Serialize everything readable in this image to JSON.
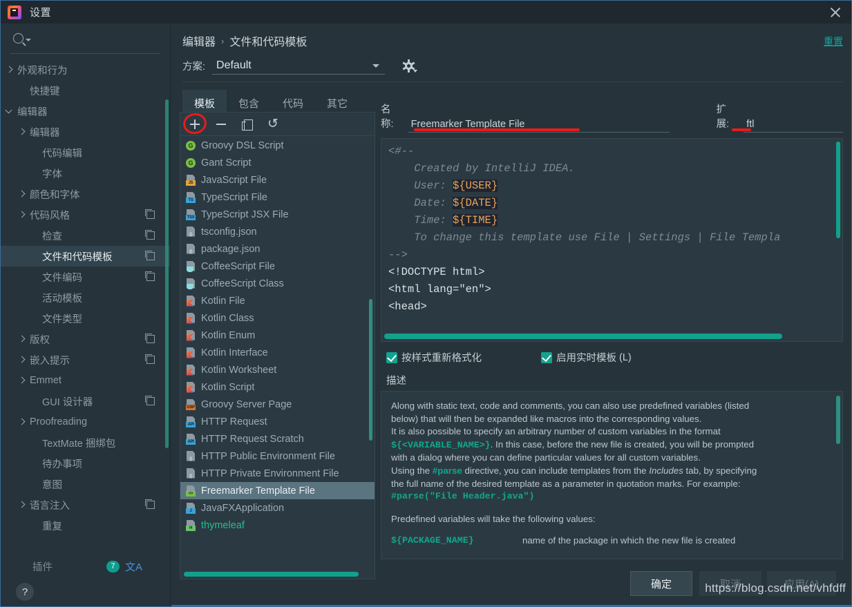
{
  "window": {
    "title": "设置",
    "close_icon": "close-icon"
  },
  "sidebar": {
    "search_placeholder": "",
    "items": [
      {
        "label": "外观和行为",
        "arrow": "right",
        "indent": 22,
        "copy": false,
        "selected": false
      },
      {
        "label": "快捷键",
        "arrow": "none",
        "indent": 40,
        "copy": false,
        "selected": false
      },
      {
        "label": "编辑器",
        "arrow": "down",
        "indent": 22,
        "copy": false,
        "selected": false
      },
      {
        "label": "编辑器",
        "arrow": "right",
        "indent": 40,
        "copy": false,
        "selected": false
      },
      {
        "label": "代码编辑",
        "arrow": "none",
        "indent": 58,
        "copy": false,
        "selected": false
      },
      {
        "label": "字体",
        "arrow": "none",
        "indent": 58,
        "copy": false,
        "selected": false
      },
      {
        "label": "颜色和字体",
        "arrow": "right",
        "indent": 40,
        "copy": false,
        "selected": false
      },
      {
        "label": "代码风格",
        "arrow": "right",
        "indent": 40,
        "copy": true,
        "selected": false
      },
      {
        "label": "检查",
        "arrow": "none",
        "indent": 58,
        "copy": true,
        "selected": false
      },
      {
        "label": "文件和代码模板",
        "arrow": "none",
        "indent": 58,
        "copy": true,
        "selected": true
      },
      {
        "label": "文件编码",
        "arrow": "none",
        "indent": 58,
        "copy": true,
        "selected": false
      },
      {
        "label": "活动模板",
        "arrow": "none",
        "indent": 58,
        "copy": false,
        "selected": false
      },
      {
        "label": "文件类型",
        "arrow": "none",
        "indent": 58,
        "copy": false,
        "selected": false
      },
      {
        "label": "版权",
        "arrow": "right",
        "indent": 40,
        "copy": true,
        "selected": false
      },
      {
        "label": "嵌入提示",
        "arrow": "right",
        "indent": 40,
        "copy": true,
        "selected": false
      },
      {
        "label": "Emmet",
        "arrow": "right",
        "indent": 40,
        "copy": false,
        "selected": false
      },
      {
        "label": "GUI 设计器",
        "arrow": "none",
        "indent": 58,
        "copy": true,
        "selected": false
      },
      {
        "label": "Proofreading",
        "arrow": "right",
        "indent": 40,
        "copy": false,
        "selected": false
      },
      {
        "label": "TextMate 捆绑包",
        "arrow": "none",
        "indent": 58,
        "copy": false,
        "selected": false
      },
      {
        "label": "待办事项",
        "arrow": "none",
        "indent": 58,
        "copy": false,
        "selected": false
      },
      {
        "label": "意图",
        "arrow": "none",
        "indent": 58,
        "copy": false,
        "selected": false
      },
      {
        "label": "语言注入",
        "arrow": "right",
        "indent": 40,
        "copy": true,
        "selected": false
      },
      {
        "label": "重复",
        "arrow": "none",
        "indent": 58,
        "copy": false,
        "selected": false
      }
    ],
    "plugins": {
      "label": "插件",
      "badge": "7",
      "lang_icon": "文A"
    },
    "help_label": "?"
  },
  "header": {
    "breadcrumb": [
      "编辑器",
      "文件和代码模板"
    ],
    "separator": "›",
    "reset_label": "重置",
    "scheme_label": "方案:",
    "scheme_value": "Default",
    "gear_icon": "gear-icon"
  },
  "tabs": [
    {
      "label": "模板",
      "active": true
    },
    {
      "label": "包含",
      "active": false
    },
    {
      "label": "代码",
      "active": false
    },
    {
      "label": "其它",
      "active": false
    }
  ],
  "list_toolbar": {
    "add": "+",
    "remove": "−",
    "copy": "copy-icon",
    "revert": "↺"
  },
  "templates": [
    {
      "name": "Groovy DSL Script",
      "icon": "groovy",
      "selected": false
    },
    {
      "name": "Gant Script",
      "icon": "groovy",
      "selected": false
    },
    {
      "name": "JavaScript File",
      "icon": "js",
      "selected": false
    },
    {
      "name": "TypeScript File",
      "icon": "ts",
      "selected": false
    },
    {
      "name": "TypeScript JSX File",
      "icon": "tsx",
      "selected": false
    },
    {
      "name": "tsconfig.json",
      "icon": "json",
      "selected": false
    },
    {
      "name": "package.json",
      "icon": "json",
      "selected": false
    },
    {
      "name": "CoffeeScript File",
      "icon": "coffee",
      "selected": false
    },
    {
      "name": "CoffeeScript Class",
      "icon": "coffee",
      "selected": false
    },
    {
      "name": "Kotlin File",
      "icon": "kotlin",
      "selected": false
    },
    {
      "name": "Kotlin Class",
      "icon": "kotlin",
      "selected": false
    },
    {
      "name": "Kotlin Enum",
      "icon": "kotlin",
      "selected": false
    },
    {
      "name": "Kotlin Interface",
      "icon": "kotlin",
      "selected": false
    },
    {
      "name": "Kotlin Worksheet",
      "icon": "kotlin",
      "selected": false
    },
    {
      "name": "Kotlin Script",
      "icon": "kotlin",
      "selected": false
    },
    {
      "name": "Groovy Server Page",
      "icon": "gsp",
      "selected": false
    },
    {
      "name": "HTTP Request",
      "icon": "api",
      "selected": false
    },
    {
      "name": "HTTP Request Scratch",
      "icon": "api",
      "selected": false
    },
    {
      "name": "HTTP Public Environment File",
      "icon": "json",
      "selected": false
    },
    {
      "name": "HTTP Private Environment File",
      "icon": "json",
      "selected": false
    },
    {
      "name": "Freemarker Template File",
      "icon": "ftl",
      "selected": true
    },
    {
      "name": "JavaFXApplication",
      "icon": "java",
      "selected": false
    },
    {
      "name": "thymeleaf",
      "icon": "html",
      "selected": false,
      "green": true
    }
  ],
  "detail": {
    "name_label": "名称:",
    "name_value": "Freemarker Template File",
    "ext_label": "扩展:",
    "ext_value": "ftl",
    "editor": {
      "line_open": "<#--",
      "line_created": "    Created by IntelliJ IDEA.",
      "line_user_label": "    User: ",
      "line_user_var": "${USER}",
      "line_date_label": "    Date: ",
      "line_date_var": "${DATE}",
      "line_time_label": "    Time: ",
      "line_time_var": "${TIME}",
      "line_tochange": "    To change this template use File | Settings | File Templa",
      "line_close": "-->",
      "line_doctype": "<!DOCTYPE html>",
      "line_html": "<html lang=\"en\">",
      "line_head": "<head>"
    },
    "checkbox_reformat": "按样式重新格式化",
    "checkbox_livetemplate": "启用实时模板",
    "checkbox_livetemplate_mnemonic": "(L)",
    "description_label": "描述",
    "description": {
      "p1_a": "Along with static text, code and comments, you can also use predefined variables (listed",
      "p1_b": "below) that will then be expanded like macros into the corresponding values.",
      "p2_a": "It is also possible to specify an arbitrary number of custom variables in the format",
      "p2_var": "${<VARIABLE_NAME>}",
      "p2_b": ". In this case, before the new file is created, you will be prompted",
      "p2_c": "with a dialog where you can define particular values for all custom variables.",
      "p3_a": "Using the ",
      "p3_kw": "#parse",
      "p3_b": " directive, you can include templates from the ",
      "p3_it": "Includes",
      "p3_c": " tab, by specifying",
      "p3_d": "the full name of the desired template as a parameter in quotation marks. For example:",
      "p3_example": "#parse(\"File Header.java\")",
      "p4": "Predefined variables will take the following values:",
      "var_name": "${PACKAGE_NAME}",
      "var_desc": "name of the package in which the new file is created"
    }
  },
  "footer": {
    "ok": "确定",
    "cancel": "取消",
    "apply": "应用(A)",
    "watermark": "https://blog.csdn.net/vhfdff"
  },
  "colors": {
    "accent": "#11a697",
    "selection": "#5a7480",
    "panel": "#2b3a42",
    "background": "#26333a",
    "annotation_red": "#e81c1c"
  }
}
